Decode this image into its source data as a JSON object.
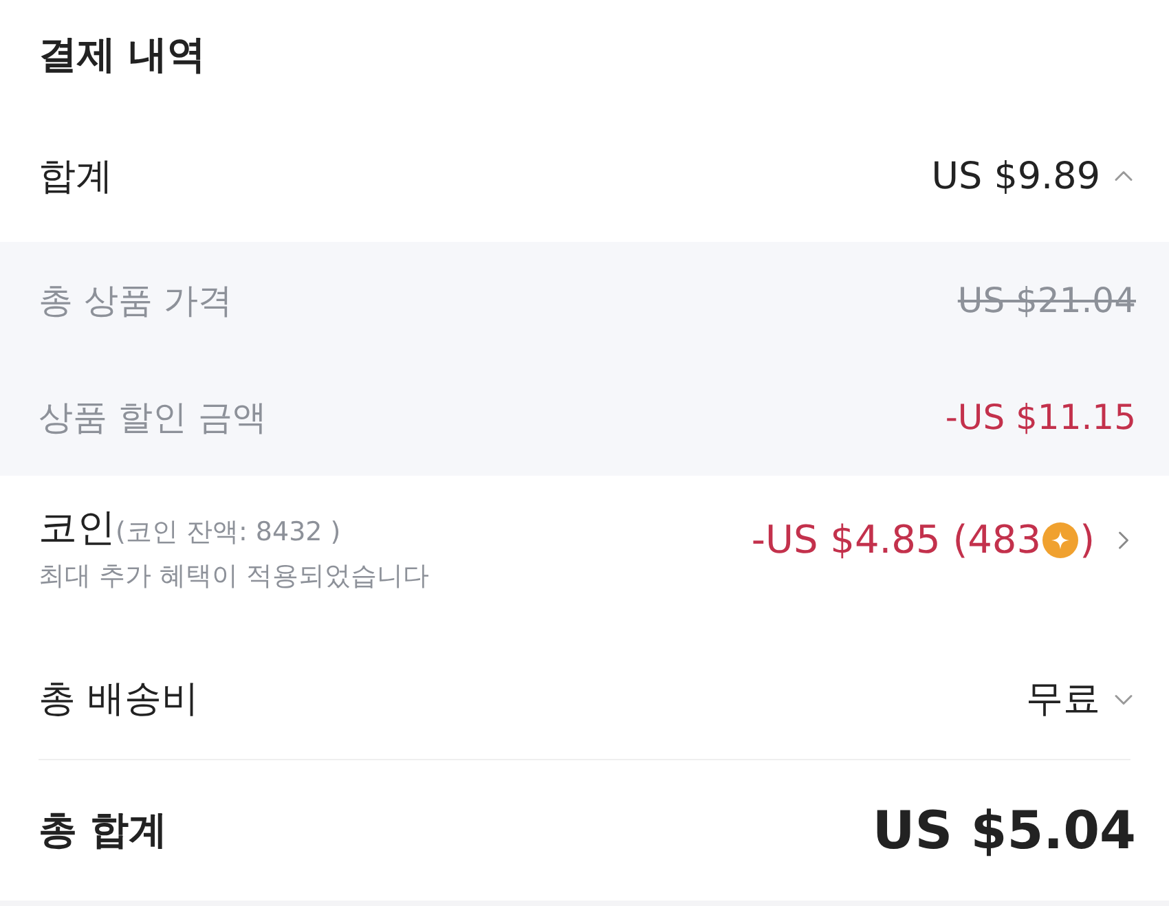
{
  "title": "결제 내역",
  "subtotal": {
    "label": "합계",
    "value": "US $9.89",
    "expanded": true
  },
  "breakdown": [
    {
      "label": "총 상품 가격",
      "value": "US $21.04",
      "kind": "strikethrough"
    },
    {
      "label": "상품 할인 금액",
      "value": "-US $11.15",
      "kind": "discount"
    }
  ],
  "coins": {
    "label": "코인",
    "balance": "(코인 잔액: 8432 )",
    "note": "최대 추가 혜택이 적용되었습니다",
    "value": "-US $4.85 (483",
    "value_end": ")"
  },
  "shipping": {
    "label": "총 배송비",
    "value": "무료",
    "expanded": false
  },
  "total": {
    "label": "총 합계",
    "value": "US $5.04"
  }
}
